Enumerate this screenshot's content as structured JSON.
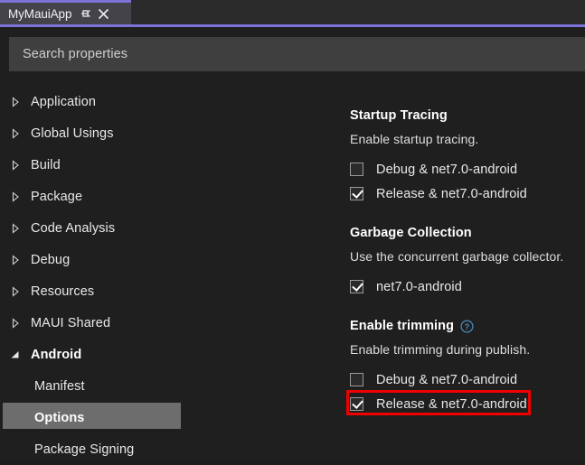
{
  "window": {
    "tab": {
      "title": "MyMauiApp",
      "pin_icon": "pin-icon",
      "close_icon": "close-icon"
    }
  },
  "search": {
    "placeholder": "Search properties",
    "value": ""
  },
  "sidebar": {
    "items": [
      {
        "label": "Application",
        "state": "collapsed",
        "level": 0
      },
      {
        "label": "Global Usings",
        "state": "collapsed",
        "level": 0
      },
      {
        "label": "Build",
        "state": "collapsed",
        "level": 0
      },
      {
        "label": "Package",
        "state": "collapsed",
        "level": 0
      },
      {
        "label": "Code Analysis",
        "state": "collapsed",
        "level": 0
      },
      {
        "label": "Debug",
        "state": "collapsed",
        "level": 0
      },
      {
        "label": "Resources",
        "state": "collapsed",
        "level": 0
      },
      {
        "label": "MAUI Shared",
        "state": "collapsed",
        "level": 0
      },
      {
        "label": "Android",
        "state": "expanded",
        "level": 0
      },
      {
        "label": "Manifest",
        "state": "leaf",
        "level": 1
      },
      {
        "label": "Options",
        "state": "leaf",
        "level": 1,
        "selected": true
      },
      {
        "label": "Package Signing",
        "state": "leaf",
        "level": 1
      }
    ]
  },
  "properties": {
    "groups": [
      {
        "title": "Startup Tracing",
        "description": "Enable startup tracing.",
        "help": false,
        "options": [
          {
            "label": "Debug & net7.0-android",
            "checked": false
          },
          {
            "label": "Release & net7.0-android",
            "checked": true
          }
        ]
      },
      {
        "title": "Garbage Collection",
        "description": "Use the concurrent garbage collector.",
        "help": false,
        "options": [
          {
            "label": "net7.0-android",
            "checked": true
          }
        ]
      },
      {
        "title": "Enable trimming",
        "description": "Enable trimming during publish.",
        "help": true,
        "help_icon": "help-circle-icon",
        "options": [
          {
            "label": "Debug & net7.0-android",
            "checked": false
          },
          {
            "label": "Release & net7.0-android",
            "checked": true,
            "annotated": true
          }
        ]
      }
    ]
  },
  "colors": {
    "accent": "#7d72d6",
    "background": "#1f1f1f",
    "tab_background": "#434349",
    "search_background": "#3f3f3f",
    "selection": "#6d6d6d",
    "annotation": "#ee0000",
    "help_icon": "#4a90c8"
  }
}
